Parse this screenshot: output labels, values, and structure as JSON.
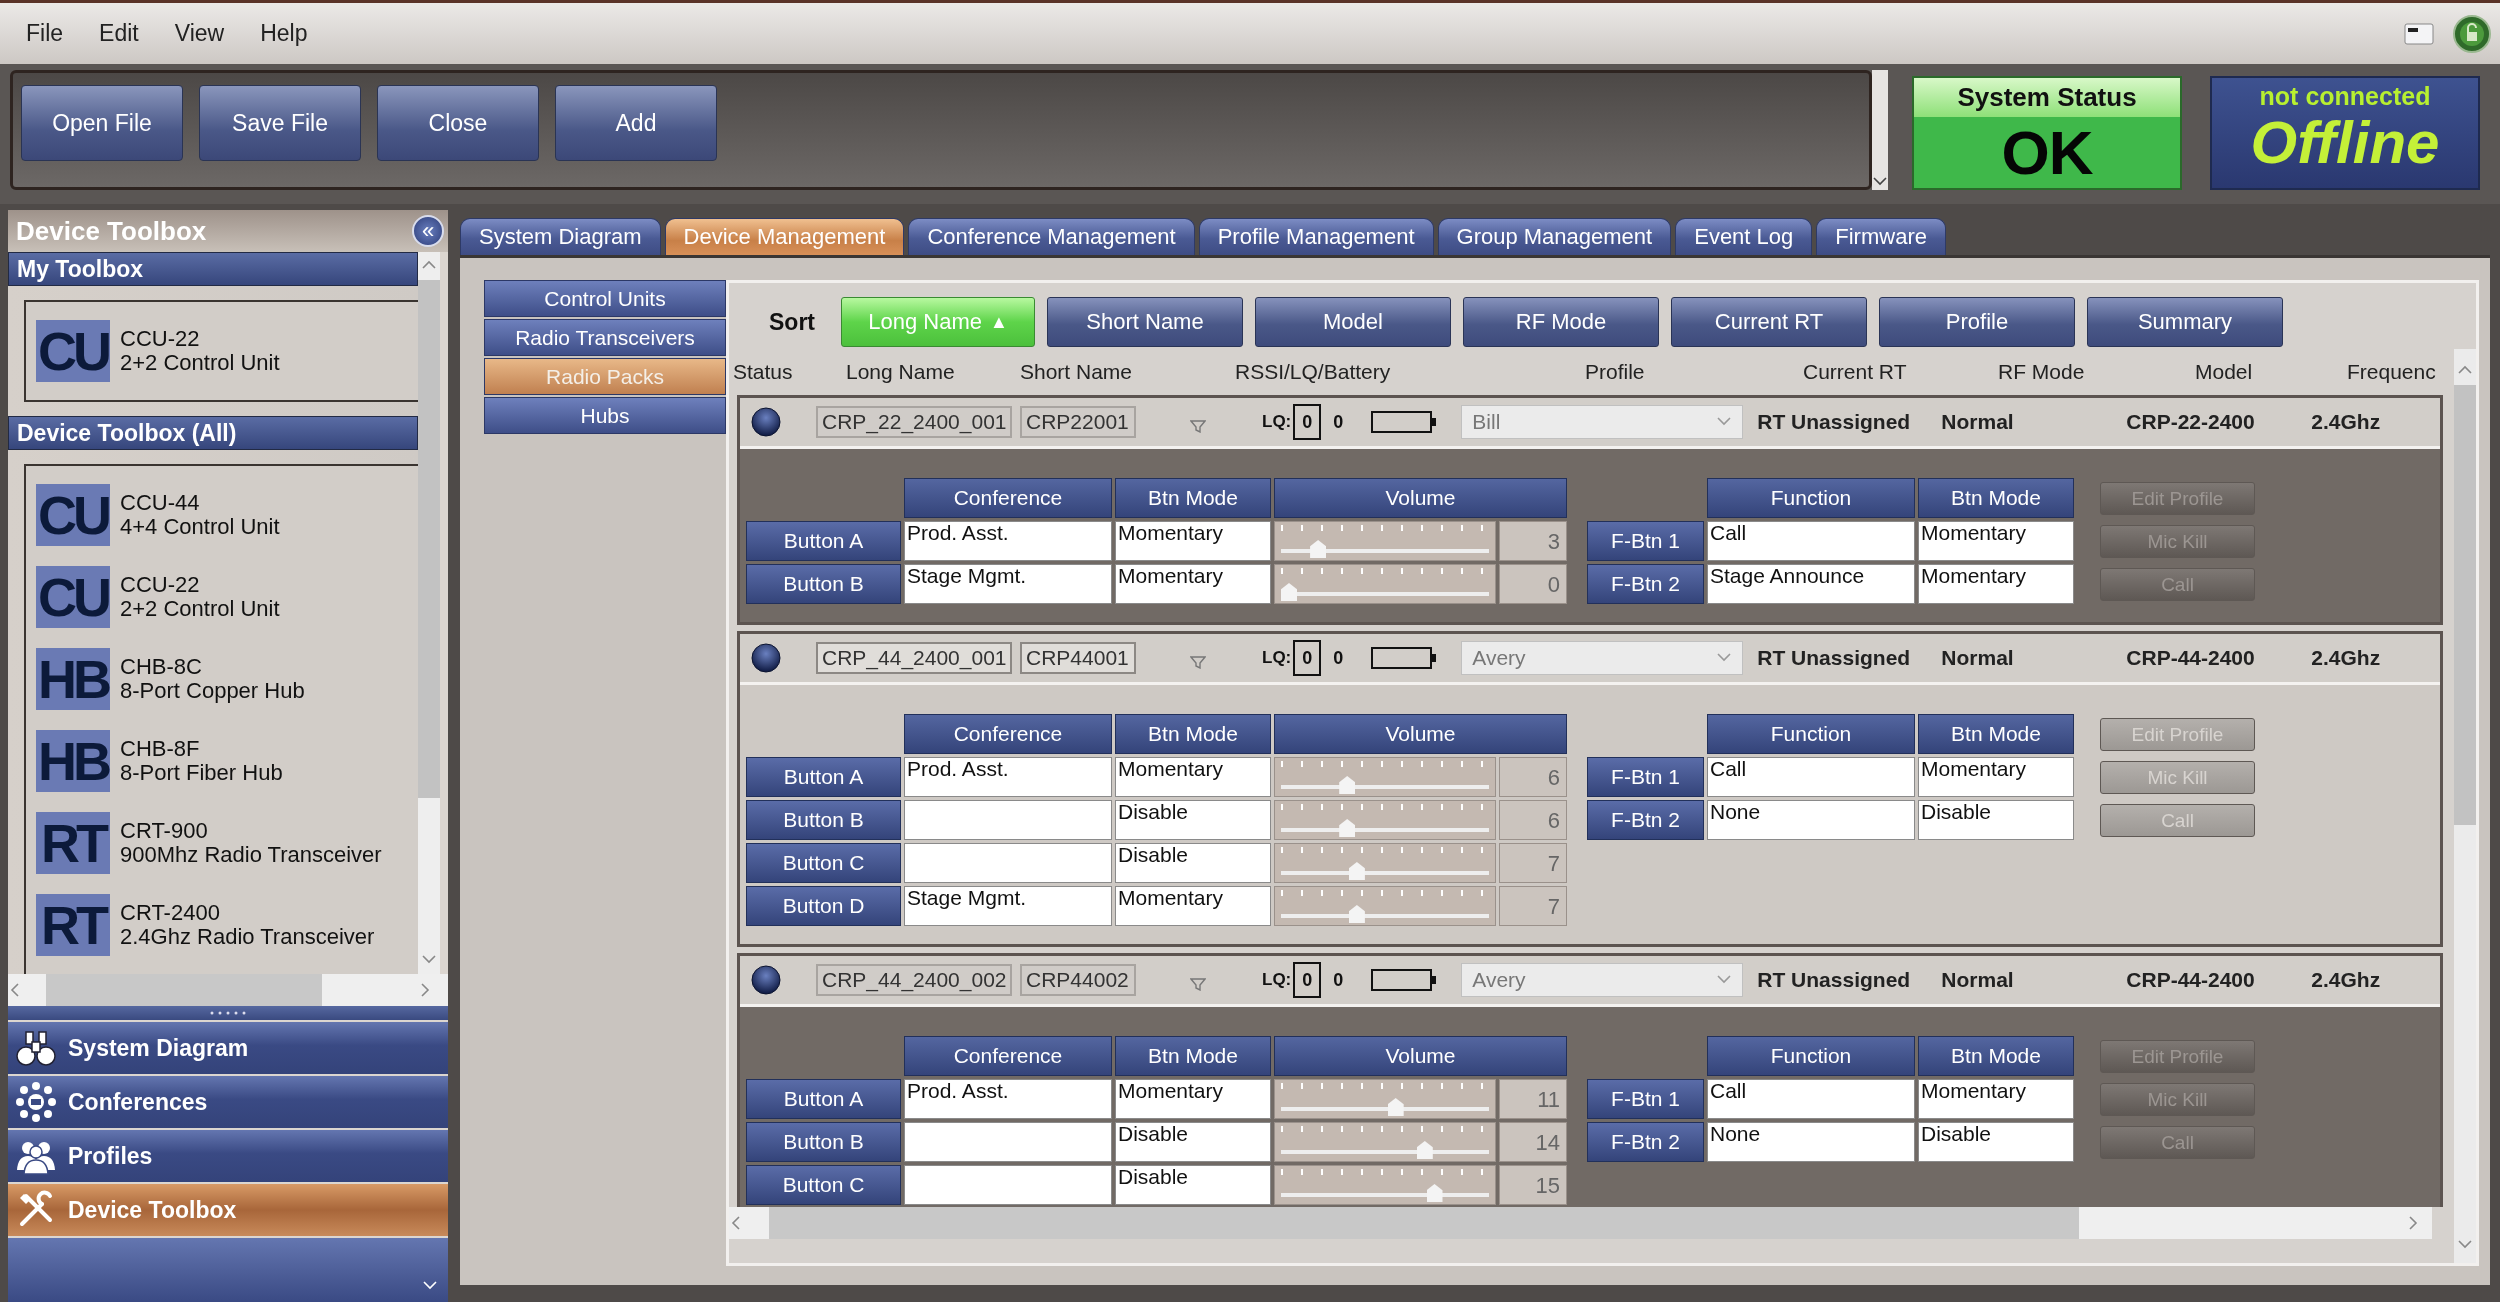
{
  "menu": [
    "File",
    "Edit",
    "View",
    "Help"
  ],
  "toolbar_buttons": [
    "Open File",
    "Save File",
    "Close",
    "Add"
  ],
  "system_status": {
    "label": "System Status",
    "value": "OK"
  },
  "connection": {
    "label": "not connected",
    "value": "Offline"
  },
  "sidebar": {
    "title": "Device Toolbox",
    "collapse_glyph": "«",
    "sections": [
      {
        "title": "My Toolbox",
        "items": [
          {
            "badge": "CU",
            "name": "CCU-22",
            "description": "2+2 Control Unit"
          }
        ]
      },
      {
        "title": "Device Toolbox (All)",
        "items": [
          {
            "badge": "CU",
            "name": "CCU-44",
            "description": "4+4 Control Unit"
          },
          {
            "badge": "CU",
            "name": "CCU-22",
            "description": "2+2 Control Unit"
          },
          {
            "badge": "HB",
            "name": "CHB-8C",
            "description": "8-Port Copper Hub"
          },
          {
            "badge": "HB",
            "name": "CHB-8F",
            "description": "8-Port Fiber Hub"
          },
          {
            "badge": "RT",
            "name": "CRT-900",
            "description": "900Mhz Radio Transceiver"
          },
          {
            "badge": "RT",
            "name": "CRT-2400",
            "description": "2.4Ghz Radio Transceiver"
          }
        ]
      }
    ],
    "nav": [
      {
        "label": "System Diagram",
        "selected": false
      },
      {
        "label": "Conferences",
        "selected": false
      },
      {
        "label": "Profiles",
        "selected": false
      },
      {
        "label": "Device Toolbox",
        "selected": true
      }
    ]
  },
  "tabs": [
    {
      "label": "System Diagram",
      "selected": false
    },
    {
      "label": "Device Management",
      "selected": true
    },
    {
      "label": "Conference Management",
      "selected": false
    },
    {
      "label": "Profile Management",
      "selected": false
    },
    {
      "label": "Group Management",
      "selected": false
    },
    {
      "label": "Event Log",
      "selected": false
    },
    {
      "label": "Firmware",
      "selected": false
    }
  ],
  "subtabs": [
    {
      "label": "Control Units",
      "selected": false
    },
    {
      "label": "Radio Transceivers",
      "selected": false
    },
    {
      "label": "Radio Packs",
      "selected": true
    },
    {
      "label": "Hubs",
      "selected": false
    }
  ],
  "sort": {
    "label": "Sort",
    "buttons": [
      {
        "label": "Long Name",
        "selected": true,
        "indicator": "▲"
      },
      {
        "label": "Short Name",
        "selected": false
      },
      {
        "label": "Model",
        "selected": false
      },
      {
        "label": "RF Mode",
        "selected": false
      },
      {
        "label": "Current RT",
        "selected": false
      },
      {
        "label": "Profile",
        "selected": false
      },
      {
        "label": "Summary",
        "selected": false
      }
    ]
  },
  "columns": [
    "Status",
    "Long Name",
    "Short Name",
    "RSSI/LQ/Battery",
    "Profile",
    "Current RT",
    "RF Mode",
    "Model",
    "Frequenc"
  ],
  "devices": [
    {
      "selected": false,
      "long_name": "CRP_22_2400_001",
      "short_name": "CRP22001",
      "lq_label": "LQ:",
      "lq": "0",
      "rssi": "0",
      "profile": "Bill",
      "current_rt": "RT Unassigned",
      "rf_mode": "Normal",
      "model": "CRP-22-2400",
      "frequency": "2.4Ghz",
      "button_columns": [
        "Conference",
        "Btn Mode",
        "Volume"
      ],
      "buttons": [
        {
          "label": "Button A",
          "conference": "Prod. Asst.",
          "mode": "Momentary",
          "level": 0.15,
          "volume": "3"
        },
        {
          "label": "Button B",
          "conference": "Stage Mgmt.",
          "mode": "Momentary",
          "level": 0.0,
          "volume": "0"
        }
      ],
      "function_columns": [
        "Function",
        "Btn Mode"
      ],
      "function_buttons": [
        {
          "label": "F-Btn 1",
          "function": "Call",
          "mode": "Momentary"
        },
        {
          "label": "F-Btn 2",
          "function": "Stage Announce",
          "mode": "Momentary"
        }
      ],
      "actions": [
        {
          "label": "Edit Profile",
          "disabled": true
        },
        {
          "label": "Mic Kill",
          "disabled": true
        },
        {
          "label": "Call",
          "disabled": true
        }
      ]
    },
    {
      "selected": true,
      "long_name": "CRP_44_2400_001",
      "short_name": "CRP44001",
      "lq_label": "LQ:",
      "lq": "0",
      "rssi": "0",
      "profile": "Avery",
      "current_rt": "RT Unassigned",
      "rf_mode": "Normal",
      "model": "CRP-44-2400",
      "frequency": "2.4Ghz",
      "button_columns": [
        "Conference",
        "Btn Mode",
        "Volume"
      ],
      "buttons": [
        {
          "label": "Button A",
          "conference": "Prod. Asst.",
          "mode": "Momentary",
          "level": 0.3,
          "volume": "6"
        },
        {
          "label": "Button B",
          "mode": "Disable",
          "level": 0.3,
          "volume": "6"
        },
        {
          "label": "Button C",
          "mode": "Disable",
          "level": 0.35,
          "volume": "7"
        },
        {
          "label": "Button D",
          "conference": "Stage Mgmt.",
          "mode": "Momentary",
          "level": 0.35,
          "volume": "7"
        }
      ],
      "function_columns": [
        "Function",
        "Btn Mode"
      ],
      "function_buttons": [
        {
          "label": "F-Btn 1",
          "function": "Call",
          "mode": "Momentary"
        },
        {
          "label": "F-Btn 2",
          "function": "None",
          "mode": "Disable"
        }
      ],
      "actions": [
        {
          "label": "Edit Profile",
          "disabled": true
        },
        {
          "label": "Mic Kill",
          "disabled": true
        },
        {
          "label": "Call",
          "disabled": true
        }
      ]
    },
    {
      "selected": false,
      "long_name": "CRP_44_2400_002",
      "short_name": "CRP44002",
      "lq_label": "LQ:",
      "lq": "0",
      "rssi": "0",
      "profile": "Avery",
      "current_rt": "RT Unassigned",
      "rf_mode": "Normal",
      "model": "CRP-44-2400",
      "frequency": "2.4Ghz",
      "button_columns": [
        "Conference",
        "Btn Mode",
        "Volume"
      ],
      "buttons": [
        {
          "label": "Button A",
          "conference": "Prod. Asst.",
          "mode": "Momentary",
          "level": 0.55,
          "volume": "11"
        },
        {
          "label": "Button B",
          "mode": "Disable",
          "level": 0.7,
          "volume": "14"
        },
        {
          "label": "Button C",
          "mode": "Disable",
          "level": 0.75,
          "volume": "15"
        }
      ],
      "function_columns": [
        "Function",
        "Btn Mode"
      ],
      "function_buttons": [
        {
          "label": "F-Btn 1",
          "function": "Call",
          "mode": "Momentary"
        },
        {
          "label": "F-Btn 2",
          "function": "None",
          "mode": "Disable"
        }
      ],
      "actions": [
        {
          "label": "Edit Profile",
          "disabled": true
        },
        {
          "label": "Mic Kill",
          "disabled": true
        },
        {
          "label": "Call",
          "disabled": true
        }
      ]
    }
  ]
}
